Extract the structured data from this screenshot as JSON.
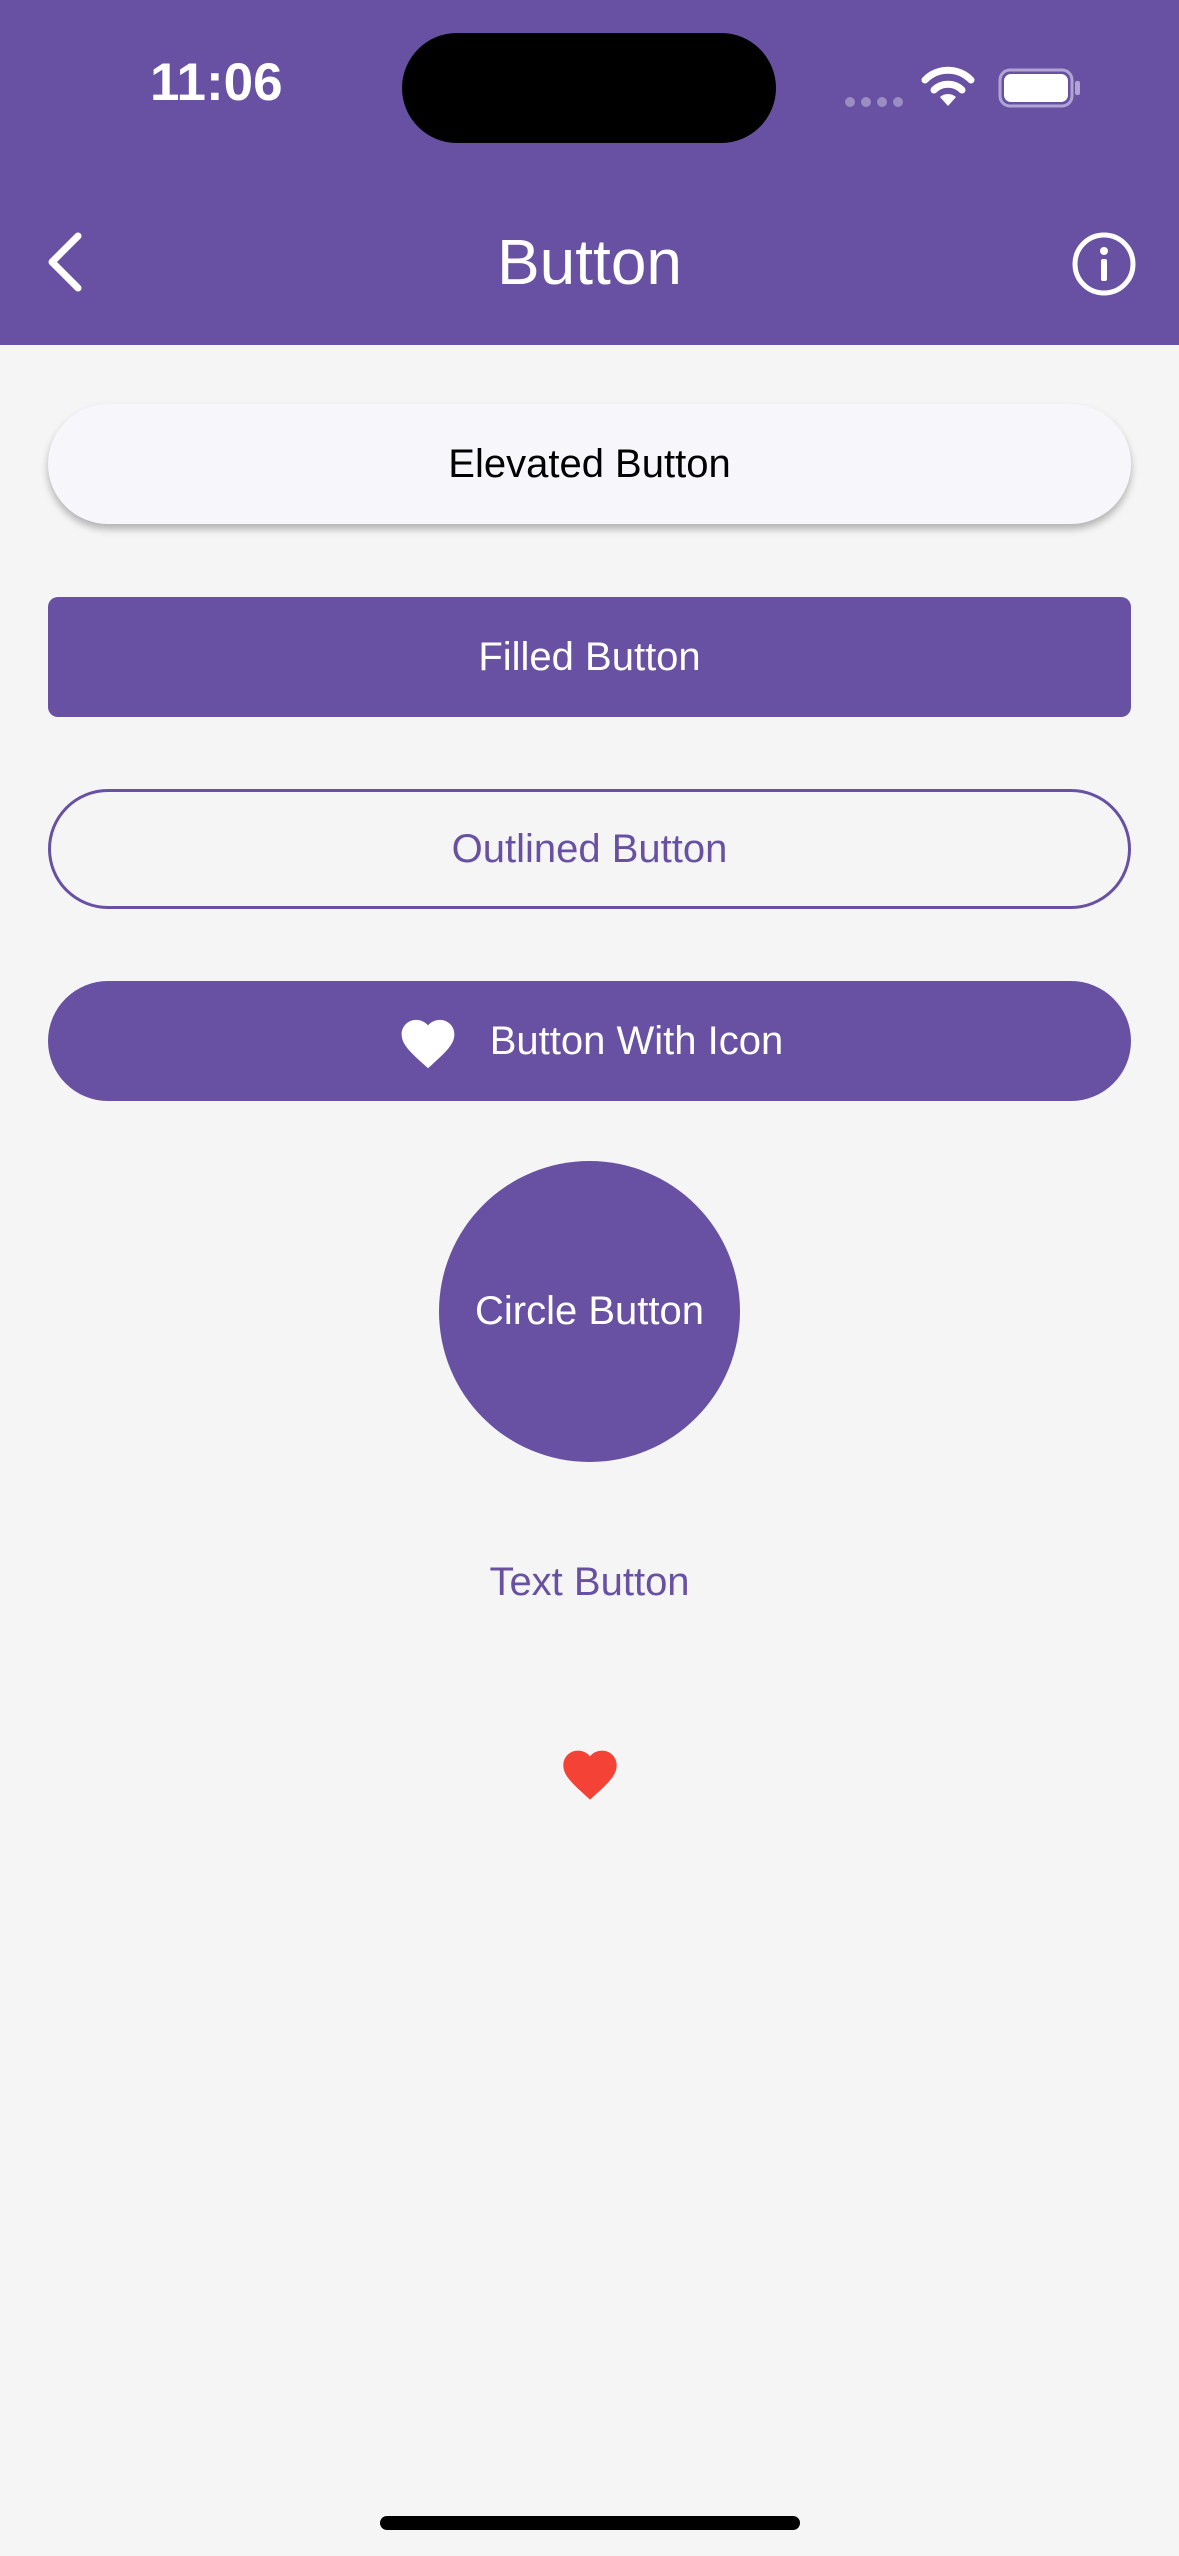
{
  "status_bar": {
    "time": "11:06"
  },
  "app_bar": {
    "title": "Button",
    "back_icon": "chevron-left-icon",
    "info_icon": "info-circle-icon"
  },
  "buttons": {
    "elevated": "Elevated Button",
    "filled": "Filled Button",
    "outlined": "Outlined Button",
    "with_icon": "Button With Icon",
    "with_icon_icon": "heart-icon",
    "circle": "Circle Button",
    "text": "Text Button",
    "icon_button_icon": "heart-icon"
  },
  "colors": {
    "primary": "#6851a2",
    "background": "#f5f5f5",
    "elevated_bg": "#f7f6fb",
    "heart_red": "#f44336"
  }
}
